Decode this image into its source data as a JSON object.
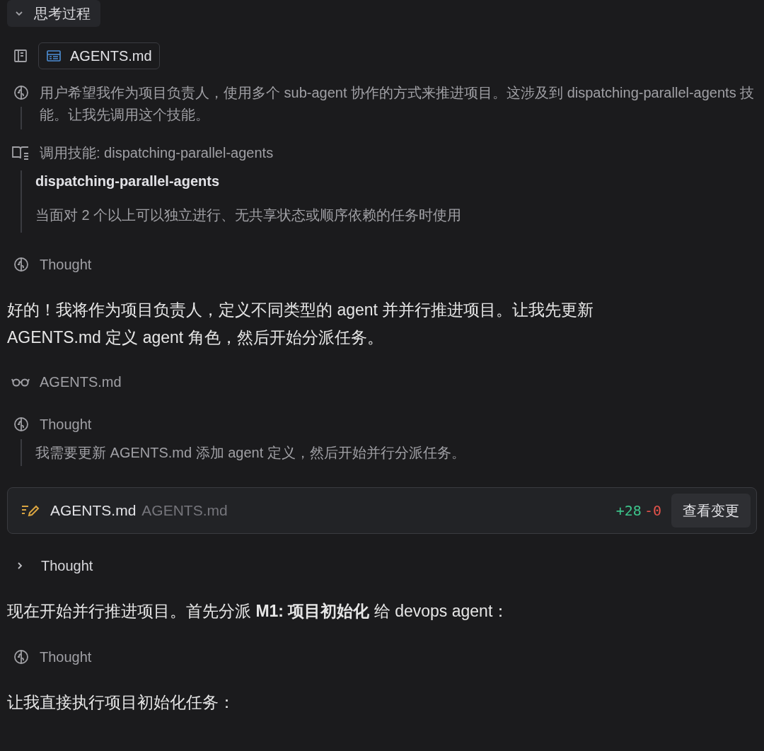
{
  "blocks": [
    {
      "kind": "toggle",
      "label": "思考过程",
      "expanded": true
    },
    {
      "kind": "file_ref",
      "file": "AGENTS.md"
    },
    {
      "kind": "thought_text",
      "text": "用户希望我作为项目负责人，使用多个 sub-agent 协作的方式来推进项目。这涉及到 dispatching-parallel-agents 技能。让我先调用这个技能。"
    },
    {
      "kind": "skill",
      "label": "调用技能: dispatching-parallel-agents",
      "title": "dispatching-parallel-agents",
      "description": "当面对 2 个以上可以独立进行、无共享状态或顺序依赖的任务时使用"
    },
    {
      "kind": "thought",
      "label": "Thought"
    },
    {
      "kind": "message",
      "text": "好的！我将作为项目负责人，定义不同类型的 agent 并并行推进项目。让我先更新 AGENTS.md 定义 agent 角色，然后开始分派任务。"
    },
    {
      "kind": "read",
      "file": "AGENTS.md"
    },
    {
      "kind": "thought",
      "label": "Thought",
      "body": "我需要更新 AGENTS.md 添加 agent 定义，然后开始并行分派任务。"
    },
    {
      "kind": "edit",
      "file": "AGENTS.md",
      "path": "AGENTS.md",
      "added": "+28",
      "removed": "-0",
      "button": "查看变更"
    },
    {
      "kind": "toggle_small",
      "label": "Thought",
      "expanded": false
    },
    {
      "kind": "message",
      "text": "现在开始并行推进项目。首先分派 **M1: 项目初始化** 给 devops agent："
    },
    {
      "kind": "thought",
      "label": "Thought"
    },
    {
      "kind": "message",
      "text": "让我直接执行项目初始化任务："
    }
  ]
}
